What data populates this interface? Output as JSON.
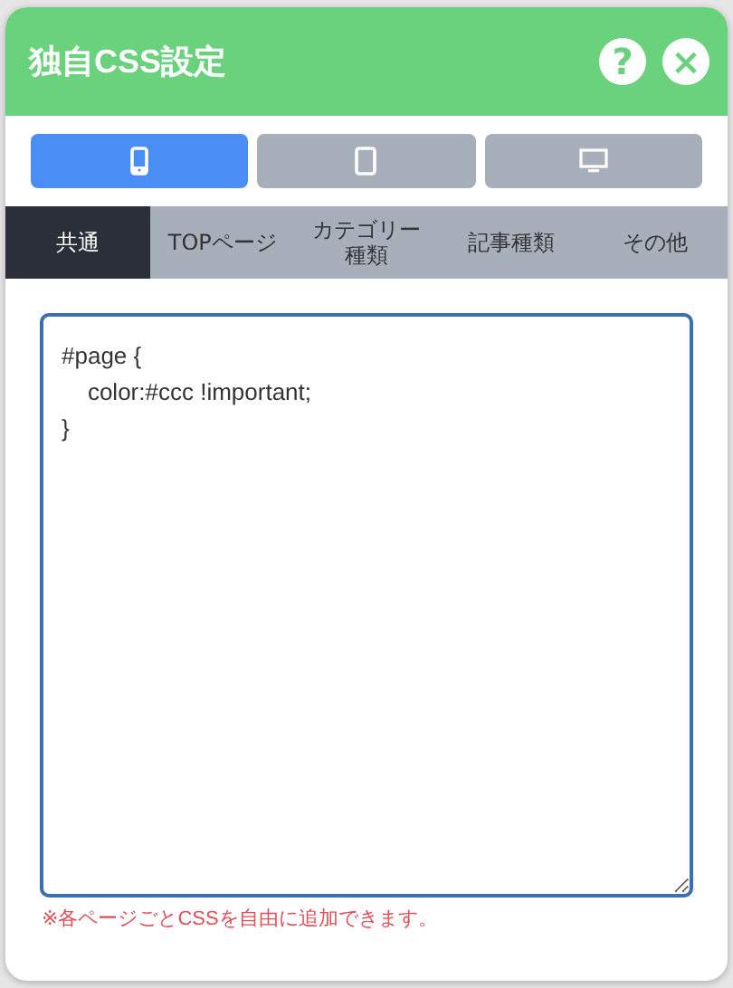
{
  "dialog": {
    "title": "独自CSS設定",
    "help_button": "?",
    "close_button": "×"
  },
  "devices": [
    {
      "kind": "phone",
      "selected": true
    },
    {
      "kind": "tablet",
      "selected": false
    },
    {
      "kind": "desktop",
      "selected": false
    }
  ],
  "tabs": [
    {
      "label": "共通",
      "selected": true
    },
    {
      "label": "TOPページ",
      "selected": false
    },
    {
      "label": "カテゴリー種類",
      "selected": false
    },
    {
      "label": "記事種類",
      "selected": false
    },
    {
      "label": "その他",
      "selected": false
    }
  ],
  "editor": {
    "value": "#page {\n    color:#ccc !important;\n}"
  },
  "note": "※各ページごとCSSを自由に追加できます。"
}
